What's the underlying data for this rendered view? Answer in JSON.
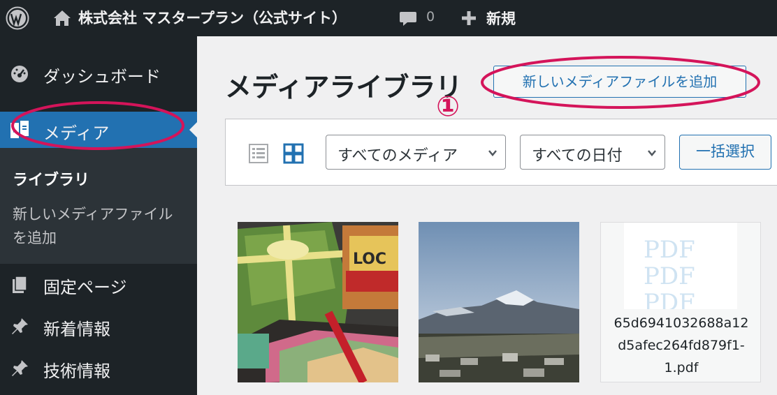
{
  "admin_bar": {
    "site_name": "株式会社 マスタープラン（公式サイト）",
    "comment_count": "0",
    "new_label": "新規"
  },
  "sidebar": {
    "dashboard": "ダッシュボード",
    "media": "メディア",
    "submenu": {
      "library": "ライブラリ",
      "add_new": "新しいメディアファイルを追加"
    },
    "pages": "固定ページ",
    "news": "新着情報",
    "tech": "技術情報"
  },
  "main": {
    "title": "メディアライブラリ",
    "add_new_button": "新しいメディアファイルを追加",
    "filters": {
      "media_type": "すべてのメディア",
      "date": "すべての日付",
      "bulk_select": "一括選択"
    },
    "items": [
      {
        "kind": "image",
        "description": "gift boxes photo"
      },
      {
        "kind": "image",
        "description": "mountain landscape photo"
      },
      {
        "kind": "document",
        "filename": "65d6941032688a12d5afec264fd879f1-1.pdf",
        "filename_lines": [
          "65d6941032688a12",
          "d5afec264fd879f1-",
          "1.pdf"
        ]
      }
    ]
  },
  "annotation": {
    "step_number": "①",
    "color": "#d4145a"
  },
  "colors": {
    "admin_bg": "#1d2327",
    "accent": "#2271b1",
    "page_bg": "#f0f0f1"
  }
}
